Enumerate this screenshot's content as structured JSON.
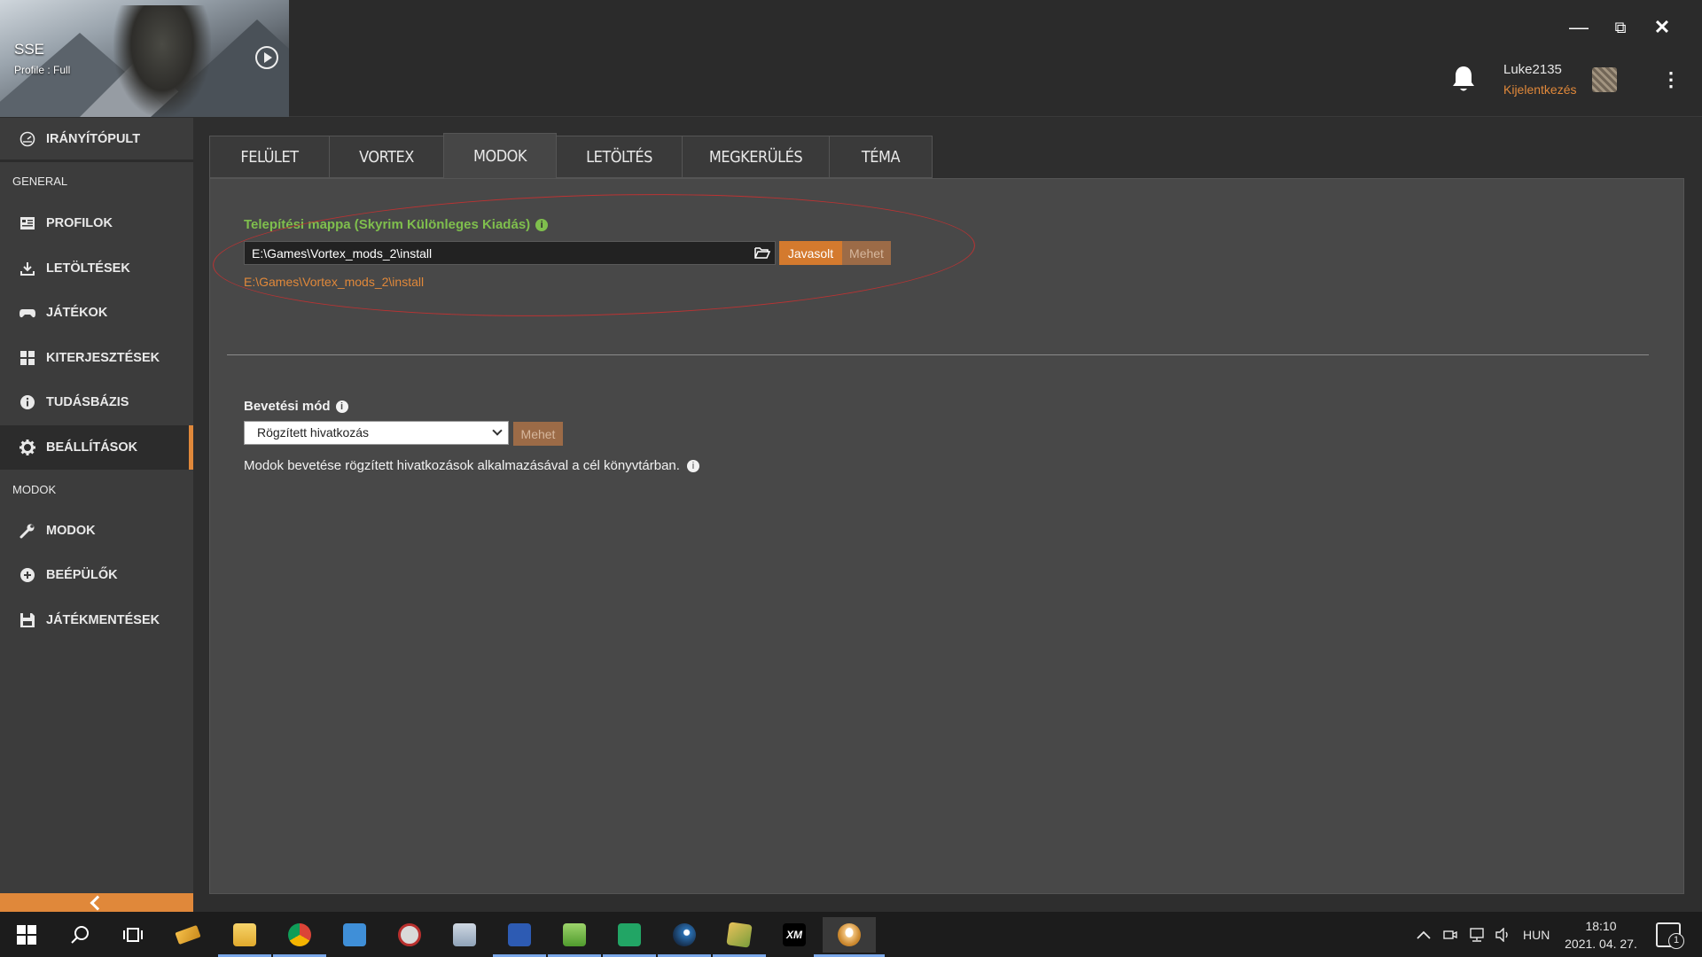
{
  "header": {
    "game_title": "SSE",
    "profile_label": "Profile : Full",
    "user_name": "Luke2135",
    "logout_label": "Kijelentkezés"
  },
  "window_controls": {
    "minimize": "—",
    "maximize": "⧉",
    "close": "✕"
  },
  "sidebar": {
    "dashboard": "IRÁNYÍTÓPULT",
    "section_general": "GENERAL",
    "section_mods": "MODOK",
    "items": [
      {
        "label": "PROFILOK",
        "icon": "profiles-icon"
      },
      {
        "label": "LETÖLTÉSEK",
        "icon": "download-icon"
      },
      {
        "label": "JÁTÉKOK",
        "icon": "gamepad-icon"
      },
      {
        "label": "KITERJESZTÉSEK",
        "icon": "extensions-icon"
      },
      {
        "label": "TUDÁSBÁZIS",
        "icon": "info-icon"
      },
      {
        "label": "BEÁLLÍTÁSOK",
        "icon": "gear-icon",
        "active": true
      },
      {
        "label": "MODOK",
        "icon": "wrench-icon"
      },
      {
        "label": "BEÉPÜLŐK",
        "icon": "plus-circle-icon"
      },
      {
        "label": "JÁTÉKMENTÉSEK",
        "icon": "save-icon"
      }
    ]
  },
  "tabs": [
    {
      "label": "FELÜLET"
    },
    {
      "label": "VORTEX"
    },
    {
      "label": "MODOK",
      "active": true
    },
    {
      "label": "LETÖLTÉS"
    },
    {
      "label": "MEGKERÜLÉS"
    },
    {
      "label": "TÉMA"
    }
  ],
  "install_folder": {
    "label": "Telepítési mappa (Skyrim Különleges Kiadás)",
    "value": "E:\\Games\\Vortex_mods_2\\install",
    "suggested_button": "Javasolt",
    "go_button": "Mehet",
    "suggested_path": "E:\\Games\\Vortex_mods_2\\install"
  },
  "deployment": {
    "label": "Bevetési mód",
    "selected": "Rögzített hivatkozás",
    "go_button": "Mehet",
    "description": "Modok bevetése rögzített hivatkozások alkalmazásával a cél könyvtárban."
  },
  "taskbar": {
    "tray_language": "HUN",
    "clock_time": "18:10",
    "clock_date": "2021. 04. 27.",
    "notification_count": "1"
  },
  "colors": {
    "accent": "#e0883a",
    "green_label": "#7fbf4d",
    "annotation_red": "#bb3333"
  }
}
